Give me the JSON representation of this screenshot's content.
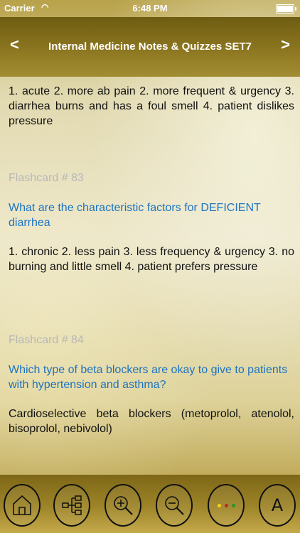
{
  "status_bar": {
    "carrier": "Carrier",
    "time": "6:48 PM"
  },
  "nav": {
    "prev_label": "<",
    "title": "Internal Medicine  Notes & Quizzes SET7",
    "next_label": ">"
  },
  "cards": [
    {
      "answer": "1. acute 2. more ab pain 2. more frequent & urgency 3. diarrhea burns and has a foul smell 4. patient dislikes pressure"
    },
    {
      "label": "Flashcard # 83",
      "question": "What are the characteristic factors for DEFICIENT diarrhea",
      "answer": "1. chronic 2. less pain 3. less frequency & urgency 3. no burning and little smell 4. patient prefers pressure"
    },
    {
      "label": "Flashcard # 84",
      "question": "Which type of beta blockers are okay to give to patients with hypertension and asthma?",
      "answer": "Cardioselective beta blockers (metoprolol, atenolol, bisoprolol, nebivolol)"
    }
  ],
  "toolbar": {
    "icons": [
      "home-icon",
      "sitemap-icon",
      "zoom-in-icon",
      "zoom-out-icon",
      "color-dots-icon",
      "font-icon"
    ],
    "font_label": "A",
    "dot_colors": [
      "#f2d21a",
      "#c0262c",
      "#2f8f2f"
    ]
  },
  "colors": {
    "question": "#1d74c0",
    "label": "#b7b7b7",
    "answer": "#111111"
  }
}
